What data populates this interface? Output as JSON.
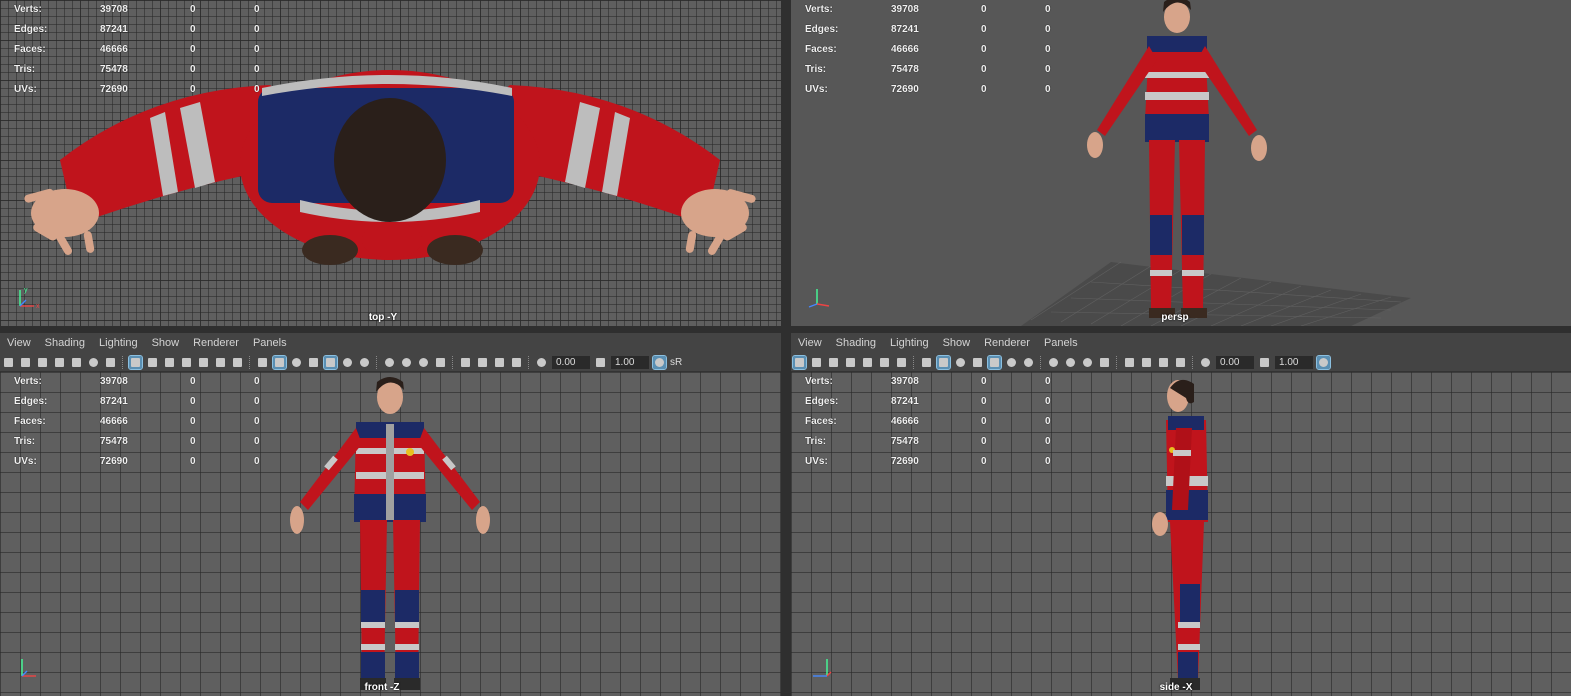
{
  "stats": [
    {
      "label": "Verts:",
      "v1": "39708",
      "v2": "0",
      "v3": "0"
    },
    {
      "label": "Edges:",
      "v1": "87241",
      "v2": "0",
      "v3": "0"
    },
    {
      "label": "Faces:",
      "v1": "46666",
      "v2": "0",
      "v3": "0"
    },
    {
      "label": "Tris:",
      "v1": "75478",
      "v2": "0",
      "v3": "0"
    },
    {
      "label": "UVs:",
      "v1": "72690",
      "v2": "0",
      "v3": "0"
    }
  ],
  "cameras": {
    "top": "top -Y",
    "persp": "persp",
    "front": "front -Z",
    "side": "side -X"
  },
  "menus": [
    "View",
    "Shading",
    "Lighting",
    "Show",
    "Renderer",
    "Panels"
  ],
  "toolbar": {
    "field_a": "0.00",
    "field_b": "1.00",
    "trailing": "sR"
  },
  "axis_labels": {
    "x": "x",
    "y": "y",
    "z": "z"
  },
  "colors": {
    "suit_red": "#c0141c",
    "suit_navy": "#1c2a66",
    "stripe": "#c8c8c8",
    "skin": "#d7a48a",
    "hair": "#2a1f1a",
    "viewport": "#5f5f5f"
  }
}
